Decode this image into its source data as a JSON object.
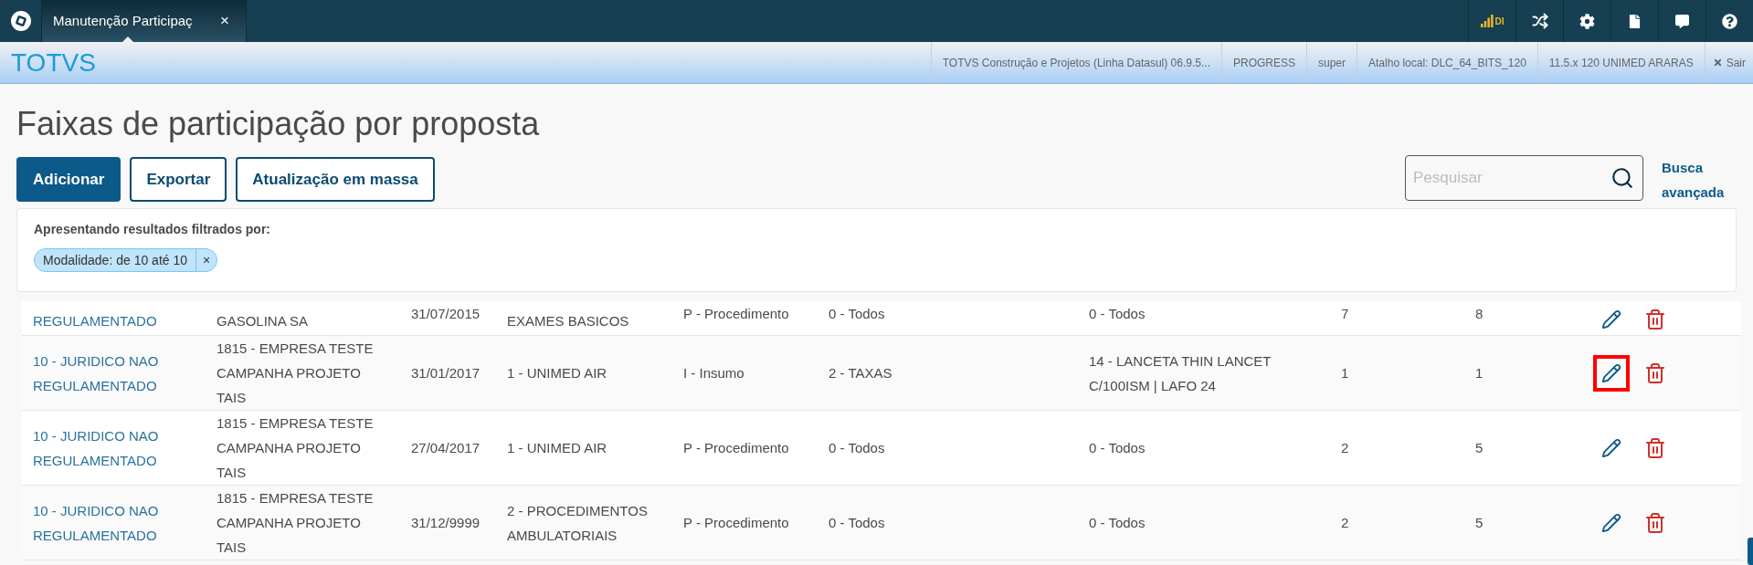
{
  "top_bar": {
    "tab": {
      "title": "Manutenção Participaç",
      "close": "×"
    },
    "signal_label": "DI"
  },
  "header": {
    "brand": "TOTVS",
    "info": [
      "TOTVS Construção e Projetos (Linha Datasul) 06.9.5...",
      "PROGRESS",
      "super",
      "Atalho local: DLC_64_BITS_120",
      "11.5.x 120 UNIMED ARARAS"
    ],
    "logout": "Sair"
  },
  "page": {
    "title": "Faixas de participação por proposta",
    "buttons": [
      {
        "label": "Adicionar",
        "kind": "primary"
      },
      {
        "label": "Exportar",
        "kind": "outline"
      },
      {
        "label": "Atualização em massa",
        "kind": "outline"
      }
    ],
    "search": {
      "placeholder": "Pesquisar"
    },
    "advanced_search": "Busca avançada"
  },
  "filters": {
    "caption": "Apresentando resultados filtrados por:",
    "tags": [
      {
        "label": "Modalidade: de 10 até 10",
        "remove": "×"
      }
    ]
  },
  "table": {
    "rows": [
      {
        "kind": "partial",
        "edit_highlighted": false,
        "cells": [
          "REGULAMENTADO",
          "GASOLINA SA",
          "31/07/2015",
          "EXAMES BASICOS",
          "P - Procedimento",
          "0 - Todos",
          "0 - Todos",
          "7",
          "8"
        ]
      },
      {
        "kind": "full",
        "edit_highlighted": true,
        "cells": [
          "10 - JURIDICO NAO REGULAMENTADO",
          "1815 - EMPRESA TESTE CAMPANHA PROJETO TAIS",
          "31/01/2017",
          "1 - UNIMED AIR",
          "I - Insumo",
          "2 - TAXAS",
          "14 - LANCETA THIN LANCET C/100ISM | LAFO 24",
          "1",
          "1"
        ]
      },
      {
        "kind": "full",
        "edit_highlighted": false,
        "cells": [
          "10 - JURIDICO NAO REGULAMENTADO",
          "1815 - EMPRESA TESTE CAMPANHA PROJETO TAIS",
          "27/04/2017",
          "1 - UNIMED AIR",
          "P - Procedimento",
          "0 - Todos",
          "0 - Todos",
          "2",
          "5"
        ]
      },
      {
        "kind": "full",
        "edit_highlighted": false,
        "cells": [
          "10 - JURIDICO NAO REGULAMENTADO",
          "1815 - EMPRESA TESTE CAMPANHA PROJETO TAIS",
          "31/12/9999",
          "2 - PROCEDIMENTOS AMBULATORIAIS",
          "P - Procedimento",
          "0 - Todos",
          "0 - Todos",
          "2",
          "5"
        ]
      }
    ]
  }
}
